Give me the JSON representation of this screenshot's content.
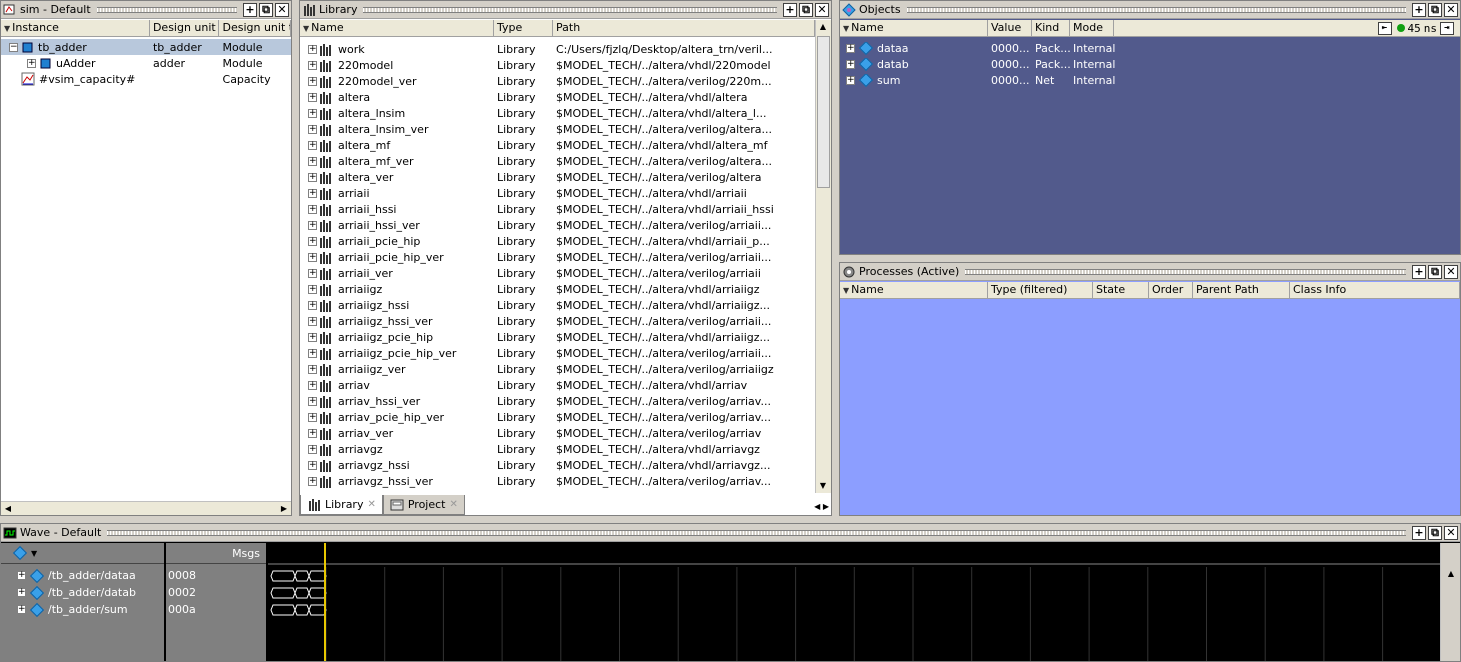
{
  "sim_pane": {
    "title": "sim - Default",
    "columns": [
      "Instance",
      "Design unit",
      "Design unit typ"
    ],
    "rows": [
      {
        "instance": "tb_adder",
        "unit": "tb_adder",
        "type": "Module",
        "expander": "-"
      },
      {
        "instance": "uAdder",
        "unit": "adder",
        "type": "Module",
        "expander": "+"
      },
      {
        "instance": "#vsim_capacity#",
        "unit": "",
        "type": "Capacity",
        "expander": ""
      }
    ]
  },
  "library_pane": {
    "title": "Library",
    "columns": [
      "Name",
      "Type",
      "Path"
    ],
    "rows": [
      [
        "work",
        "Library",
        "C:/Users/fjzlq/Desktop/altera_trn/veril..."
      ],
      [
        "220model",
        "Library",
        "$MODEL_TECH/../altera/vhdl/220model"
      ],
      [
        "220model_ver",
        "Library",
        "$MODEL_TECH/../altera/verilog/220m..."
      ],
      [
        "altera",
        "Library",
        "$MODEL_TECH/../altera/vhdl/altera"
      ],
      [
        "altera_lnsim",
        "Library",
        "$MODEL_TECH/../altera/vhdl/altera_l..."
      ],
      [
        "altera_lnsim_ver",
        "Library",
        "$MODEL_TECH/../altera/verilog/altera..."
      ],
      [
        "altera_mf",
        "Library",
        "$MODEL_TECH/../altera/vhdl/altera_mf"
      ],
      [
        "altera_mf_ver",
        "Library",
        "$MODEL_TECH/../altera/verilog/altera..."
      ],
      [
        "altera_ver",
        "Library",
        "$MODEL_TECH/../altera/verilog/altera"
      ],
      [
        "arriaii",
        "Library",
        "$MODEL_TECH/../altera/vhdl/arriaii"
      ],
      [
        "arriaii_hssi",
        "Library",
        "$MODEL_TECH/../altera/vhdl/arriaii_hssi"
      ],
      [
        "arriaii_hssi_ver",
        "Library",
        "$MODEL_TECH/../altera/verilog/arriaii..."
      ],
      [
        "arriaii_pcie_hip",
        "Library",
        "$MODEL_TECH/../altera/vhdl/arriaii_p..."
      ],
      [
        "arriaii_pcie_hip_ver",
        "Library",
        "$MODEL_TECH/../altera/verilog/arriaii..."
      ],
      [
        "arriaii_ver",
        "Library",
        "$MODEL_TECH/../altera/verilog/arriaii"
      ],
      [
        "arriaiigz",
        "Library",
        "$MODEL_TECH/../altera/vhdl/arriaiigz"
      ],
      [
        "arriaiigz_hssi",
        "Library",
        "$MODEL_TECH/../altera/vhdl/arriaiigz..."
      ],
      [
        "arriaiigz_hssi_ver",
        "Library",
        "$MODEL_TECH/../altera/verilog/arriaii..."
      ],
      [
        "arriaiigz_pcie_hip",
        "Library",
        "$MODEL_TECH/../altera/vhdl/arriaiigz..."
      ],
      [
        "arriaiigz_pcie_hip_ver",
        "Library",
        "$MODEL_TECH/../altera/verilog/arriaii..."
      ],
      [
        "arriaiigz_ver",
        "Library",
        "$MODEL_TECH/../altera/verilog/arriaiigz"
      ],
      [
        "arriav",
        "Library",
        "$MODEL_TECH/../altera/vhdl/arriav"
      ],
      [
        "arriav_hssi_ver",
        "Library",
        "$MODEL_TECH/../altera/verilog/arriav..."
      ],
      [
        "arriav_pcie_hip_ver",
        "Library",
        "$MODEL_TECH/../altera/verilog/arriav..."
      ],
      [
        "arriav_ver",
        "Library",
        "$MODEL_TECH/../altera/verilog/arriav"
      ],
      [
        "arriavgz",
        "Library",
        "$MODEL_TECH/../altera/vhdl/arriavgz"
      ],
      [
        "arriavgz_hssi",
        "Library",
        "$MODEL_TECH/../altera/vhdl/arriavgz..."
      ],
      [
        "arriavgz_hssi_ver",
        "Library",
        "$MODEL_TECH/../altera/verilog/arriav..."
      ]
    ],
    "tabs": [
      {
        "label": "Library",
        "active": true
      },
      {
        "label": "Project",
        "active": false
      }
    ]
  },
  "objects_pane": {
    "title": "Objects",
    "columns": [
      "Name",
      "Value",
      "Kind",
      "Mode"
    ],
    "rows": [
      [
        "dataa",
        "0000...",
        "Pack...",
        "Internal"
      ],
      [
        "datab",
        "0000...",
        "Pack...",
        "Internal"
      ],
      [
        "sum",
        "0000...",
        "Net",
        "Internal"
      ]
    ],
    "time_value": "45",
    "time_unit": "ns",
    "bg_color": "#525a8c"
  },
  "processes_pane": {
    "title": "Processes (Active)",
    "columns": [
      "Name",
      "Type (filtered)",
      "State",
      "Order",
      "Parent Path",
      "Class Info"
    ],
    "bg_color": "#8c9eff"
  },
  "wave_pane": {
    "title": "Wave - Default",
    "msgs_label": "Msgs",
    "signals": [
      {
        "name": "/tb_adder/dataa",
        "value": "0008"
      },
      {
        "name": "/tb_adder/datab",
        "value": "0002"
      },
      {
        "name": "/tb_adder/sum",
        "value": "000a"
      }
    ],
    "cursor_color": "#e8c800",
    "wave_color": "#ffffff"
  }
}
